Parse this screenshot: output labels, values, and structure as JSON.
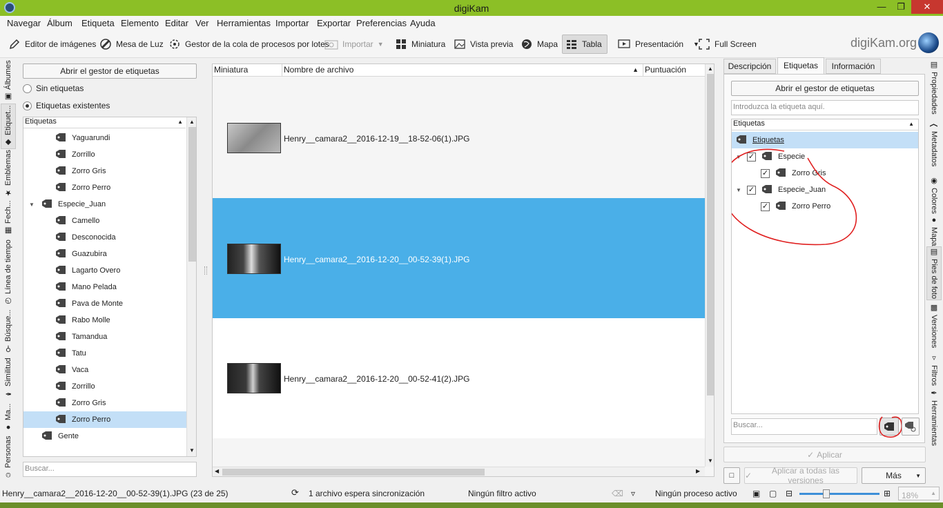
{
  "window": {
    "title": "digiKam"
  },
  "menu": [
    "Navegar",
    "Álbum",
    "Etiqueta",
    "Elemento",
    "Editar",
    "Ver",
    "Herramientas",
    "Importar",
    "Exportar",
    "Preferencias",
    "Ayuda"
  ],
  "toolbar": {
    "image_editor": "Editor de imágenes",
    "light_table": "Mesa de Luz",
    "batch_queue": "Gestor de la cola de procesos por lotes",
    "import": "Importar",
    "thumbnail": "Miniatura",
    "preview": "Vista previa",
    "map": "Mapa",
    "table": "Tabla",
    "slideshow": "Presentación",
    "fullscreen": "Full Screen",
    "brand": "digiKam.org"
  },
  "left_tabs": [
    "Álbumes",
    "Etiquet...",
    "Emblemas",
    "Fech...",
    "Línea de tiempo",
    "Búsque...",
    "Similitud",
    "Ma...",
    "Personas"
  ],
  "left_panel": {
    "open_tag_manager": "Abrir el gestor de etiquetas",
    "no_tags": "Sin etiquetas",
    "existing_tags": "Etiquetas existentes",
    "tree_header": "Etiquetas",
    "search_placeholder": "Buscar...",
    "tree": [
      {
        "label": "Yaguarundi",
        "level": 2
      },
      {
        "label": "Zorrillo",
        "level": 2
      },
      {
        "label": "Zorro Gris",
        "level": 2
      },
      {
        "label": "Zorro Perro",
        "level": 2
      },
      {
        "label": "Especie_Juan",
        "level": 1
      },
      {
        "label": "Camello",
        "level": 2
      },
      {
        "label": "Desconocida",
        "level": 2
      },
      {
        "label": "Guazubira",
        "level": 2
      },
      {
        "label": "Lagarto Overo",
        "level": 2
      },
      {
        "label": "Mano Pelada",
        "level": 2
      },
      {
        "label": "Pava de Monte",
        "level": 2
      },
      {
        "label": "Rabo Molle",
        "level": 2
      },
      {
        "label": "Tamandua",
        "level": 2
      },
      {
        "label": "Tatu",
        "level": 2
      },
      {
        "label": "Vaca",
        "level": 2
      },
      {
        "label": "Zorrillo",
        "level": 2
      },
      {
        "label": "Zorro Gris",
        "level": 2
      },
      {
        "label": "Zorro Perro",
        "level": 2,
        "selected": true
      },
      {
        "label": "Gente",
        "level": 1
      }
    ]
  },
  "table": {
    "columns": [
      "Miniatura",
      "Nombre de archivo",
      "Puntuación"
    ],
    "rows": [
      {
        "file": "Henry__camara2__2016-12-19__18-52-06(1).JPG"
      },
      {
        "file": "Henry__camara2__2016-12-20__00-52-39(1).JPG",
        "selected": true
      },
      {
        "file": "Henry__camara2__2016-12-20__00-52-41(2).JPG"
      }
    ]
  },
  "right_panel": {
    "tabs": [
      "Descripción",
      "Etiquetas",
      "Información"
    ],
    "open_tag_manager": "Abrir el gestor de etiquetas",
    "tag_input_placeholder": "Introduzca la etiqueta aquí.",
    "tree_header": "Etiquetas",
    "tree": [
      {
        "label": "Etiquetas",
        "level": 0,
        "selected": true
      },
      {
        "label": "Especie",
        "level": 1,
        "checked": true
      },
      {
        "label": "Zorro Gris",
        "level": 2,
        "checked": true
      },
      {
        "label": "Especie_Juan",
        "level": 1,
        "checked": true
      },
      {
        "label": "Zorro Perro",
        "level": 2,
        "checked": true
      }
    ],
    "search_placeholder": "Buscar...",
    "apply": "Aplicar",
    "apply_all": "Aplicar a todas las versiones",
    "more": "Más"
  },
  "right_tabs": [
    "Propiedades",
    "Metadatos",
    "Colores",
    "Mapa",
    "Pies de foto",
    "Versiones",
    "Filtros",
    "Herramientas"
  ],
  "status": {
    "current_file": "Henry__camara2__2016-12-20__00-52-39(1).JPG (23 de 25)",
    "sync": "1 archivo espera sincronización",
    "filter": "Ningún filtro activo",
    "process": "Ningún proceso activo",
    "zoom": "18%"
  },
  "colors": {
    "title_bar": "#8cbf26",
    "selection": "#4aafe8",
    "tree_selection": "#c3dff7",
    "annotation": "#e02020"
  }
}
